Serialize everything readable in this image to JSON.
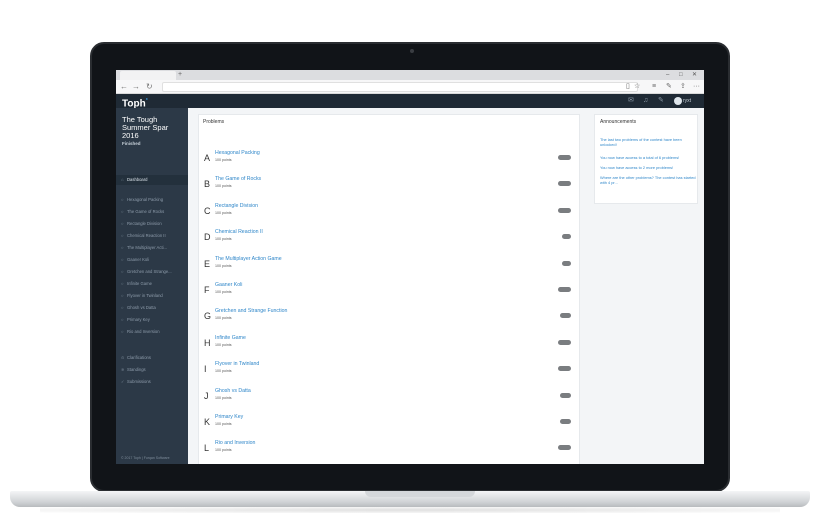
{
  "browser": {
    "new_tab": "+",
    "back": "←",
    "forward": "→",
    "reload": "↻",
    "minimize": "–",
    "maximize": "□",
    "close": "✕"
  },
  "header": {
    "logo": "Toph",
    "logo_mark": "°",
    "username": "ryxt"
  },
  "sidebar": {
    "contest_title": "The Tough Summer Spar 2016",
    "contest_status": "Finished",
    "items": [
      {
        "icon": "⌂",
        "label": "Dashboard"
      },
      {
        "icon": "○",
        "label": "Hexagonal Packing"
      },
      {
        "icon": "○",
        "label": "The Game of Rocks"
      },
      {
        "icon": "○",
        "label": "Rectangle Division"
      },
      {
        "icon": "○",
        "label": "Chemical Reaction II"
      },
      {
        "icon": "○",
        "label": "The Multiplayer Acti..."
      },
      {
        "icon": "○",
        "label": "Gaaner Koli"
      },
      {
        "icon": "○",
        "label": "Gretchen and Strange..."
      },
      {
        "icon": "○",
        "label": "Infinite Game"
      },
      {
        "icon": "○",
        "label": "Flyover in Twinland"
      },
      {
        "icon": "○",
        "label": "Ghosh vs Datta"
      },
      {
        "icon": "○",
        "label": "Primary Key"
      },
      {
        "icon": "○",
        "label": "Rio and Inversion"
      },
      {
        "icon": "⊙",
        "label": "Clarifications"
      },
      {
        "icon": "≋",
        "label": "Standings"
      },
      {
        "icon": "✓",
        "label": "Submissions"
      }
    ],
    "footer": "© 2017 Toph | Furqan Software"
  },
  "problems": {
    "heading": "Problems",
    "items": [
      {
        "letter": "A",
        "name": "Hexagonal Packing",
        "points": "100 points"
      },
      {
        "letter": "B",
        "name": "The Game of Rocks",
        "points": "100 points"
      },
      {
        "letter": "C",
        "name": "Rectangle Division",
        "points": "100 points"
      },
      {
        "letter": "D",
        "name": "Chemical Reaction II",
        "points": "100 points"
      },
      {
        "letter": "E",
        "name": "The Multiplayer Action Game",
        "points": "100 points"
      },
      {
        "letter": "F",
        "name": "Gaaner Koli",
        "points": "100 points"
      },
      {
        "letter": "G",
        "name": "Gretchen and Strange Function",
        "points": "100 points"
      },
      {
        "letter": "H",
        "name": "Infinite Game",
        "points": "100 points"
      },
      {
        "letter": "I",
        "name": "Flyover in Twinland",
        "points": "100 points"
      },
      {
        "letter": "J",
        "name": "Ghosh vs Datta",
        "points": "100 points"
      },
      {
        "letter": "K",
        "name": "Primary Key",
        "points": "100 points"
      },
      {
        "letter": "L",
        "name": "Rio and Inversion",
        "points": "100 points"
      }
    ]
  },
  "announcements": {
    "heading": "Announcements",
    "items": [
      "The last two problems of the contest have been unlocked!",
      "You now have access to a total of 6 problems!",
      "You now have access to 2 more problems!",
      "Where are the other problems? The contest has started with 4 pr..."
    ]
  },
  "colors": {
    "appbar": "#1f2a35",
    "sidebar": "#2c3947",
    "link": "#2e86c9",
    "badge": "#7a7d80"
  }
}
